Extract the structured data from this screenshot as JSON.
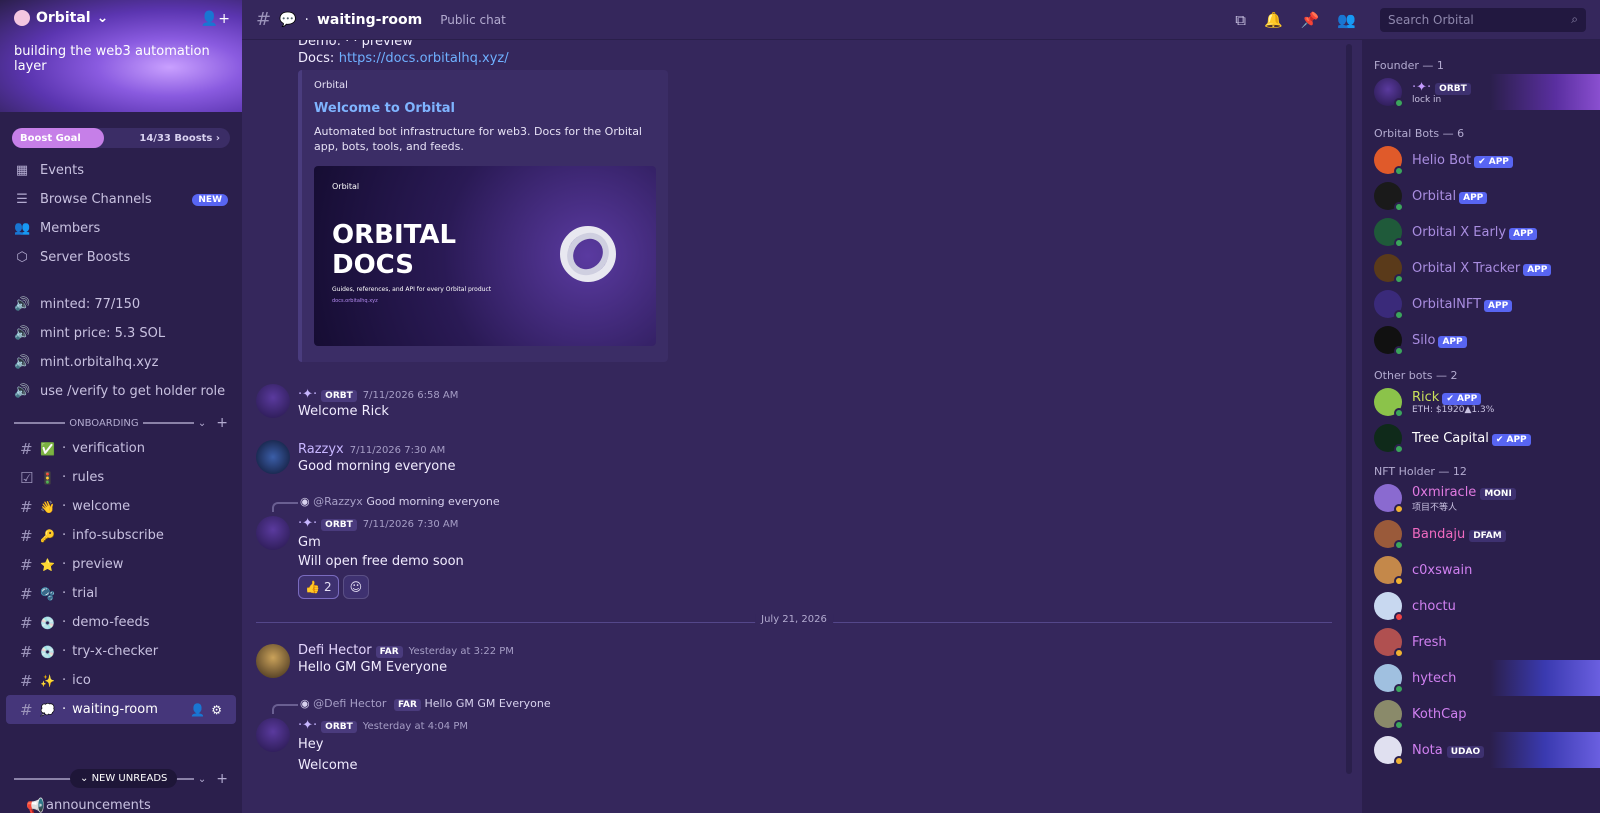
{
  "server": {
    "name": "Orbital",
    "tagline": "building the web3 automation layer",
    "boost": {
      "label": "Boost Goal",
      "count": "14/33 Boosts",
      "progress": 0.42
    }
  },
  "sidebar": {
    "nav": [
      {
        "label": "Events",
        "icon": "calendar-icon"
      },
      {
        "label": "Browse Channels",
        "icon": "browse-icon",
        "badge": "NEW"
      },
      {
        "label": "Members",
        "icon": "members-icon"
      },
      {
        "label": "Server Boosts",
        "icon": "boost-icon"
      }
    ],
    "stats": [
      "minted: 77/150",
      "mint price: 5.3 SOL",
      "mint.orbitalhq.xyz",
      "use /verify to get holder role"
    ],
    "category": "ONBOARDING",
    "channels": [
      {
        "name": "verification",
        "emoji": "✅"
      },
      {
        "name": "rules",
        "emoji": "🚦"
      },
      {
        "name": "welcome",
        "emoji": "👋"
      },
      {
        "name": "info-subscribe",
        "emoji": "🔑"
      },
      {
        "name": "preview",
        "emoji": "⭐"
      },
      {
        "name": "trial",
        "emoji": "🫧"
      },
      {
        "name": "demo-feeds",
        "emoji": "💿"
      },
      {
        "name": "try-x-checker",
        "emoji": "💿"
      },
      {
        "name": "ico",
        "emoji": "✨"
      },
      {
        "name": "waiting-room",
        "emoji": "💭"
      }
    ],
    "new_unreads": "NEW UNREADS",
    "partial_channel": "announcements"
  },
  "header": {
    "channel": "waiting-room",
    "topic": "Public chat",
    "search_placeholder": "Search Orbital"
  },
  "messages": {
    "top_cut": "Demo:  ·  ·  preview",
    "docs_label": "Docs:",
    "docs_link": "https://docs.orbitalhq.xyz/",
    "embed": {
      "provider": "Orbital",
      "title": "Welcome to Orbital",
      "description": "Automated bot infrastructure for web3. Docs for the Orbital app, bots, tools, and feeds.",
      "image_brand": "Orbital",
      "image_title": "ORBITAL\nDOCS",
      "image_sub": "Guides, references, and API for every Orbital product",
      "image_url": "docs.orbitalhq.xyz"
    },
    "m1": {
      "badge": "ORBT",
      "time": "7/11/2026 6:58 AM",
      "text": "Welcome Rick"
    },
    "m2": {
      "user": "Razzyx",
      "time": "7/11/2026 7:30 AM",
      "text": "Good morning everyone"
    },
    "m3": {
      "reply_user": "@Razzyx",
      "reply_text": "Good morning everyone",
      "badge": "ORBT",
      "time": "7/11/2026 7:30 AM",
      "text1": "Gm",
      "text2": "Will open free demo soon",
      "reaction_count": "2"
    },
    "divider": "July 21, 2026",
    "m4": {
      "user": "Defi Hector",
      "badge": "FAR",
      "time": "Yesterday at 3:22 PM",
      "text": "Hello GM GM Everyone"
    },
    "m5": {
      "reply_user": "@Defi Hector",
      "reply_badge": "FAR",
      "reply_text": "Hello GM GM Everyone",
      "badge": "ORBT",
      "time": "Yesterday at 4:04 PM",
      "text1": "Hey",
      "text2": "Welcome"
    }
  },
  "members": {
    "founder_head": "Founder — 1",
    "founder": {
      "badge": "ORBT",
      "status": "lock in"
    },
    "bots_head": "Orbital Bots — 6",
    "bots": [
      {
        "name": "Helio Bot",
        "app": "✔ APP",
        "color": "#e05a2a"
      },
      {
        "name": "Orbital",
        "app": "APP",
        "color": "#1a1a1a"
      },
      {
        "name": "Orbital X Early",
        "app": "APP",
        "color": "#1f5a3a"
      },
      {
        "name": "Orbital X Tracker",
        "app": "APP",
        "color": "#5a3a1a"
      },
      {
        "name": "OrbitalNFT",
        "app": "APP",
        "color": "#3a2a7a"
      },
      {
        "name": "Silo",
        "app": "APP",
        "color": "#111111"
      }
    ],
    "other_head": "Other bots — 2",
    "rick": {
      "name": "Rick",
      "app": "✔ APP",
      "status": "ETH: $1920▲1.3%"
    },
    "tree": {
      "name": "Tree Capital",
      "app": "✔ APP"
    },
    "holder_head": "NFT Holder — 12",
    "holders": [
      {
        "name": "0xmiracle",
        "tag": "MONI",
        "status": "项目不等人"
      },
      {
        "name": "Bandaju",
        "tag": "DFAM"
      },
      {
        "name": "c0xswain"
      },
      {
        "name": "choctu"
      },
      {
        "name": "Fresh"
      },
      {
        "name": "hytech"
      },
      {
        "name": "KothCap"
      },
      {
        "name": "Nota",
        "tag": "UDAO"
      }
    ]
  }
}
